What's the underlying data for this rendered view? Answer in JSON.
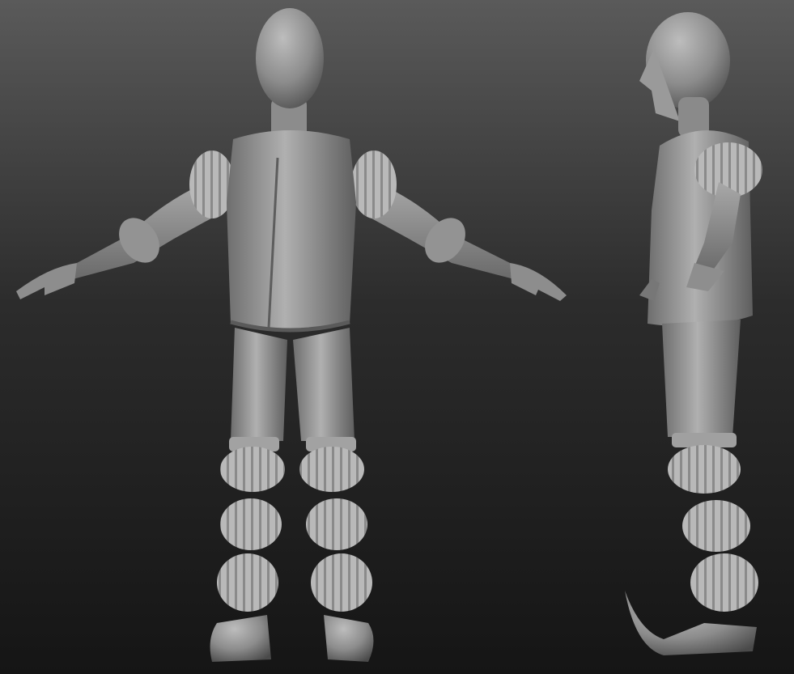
{
  "scene": {
    "background_top": "#5a5a5a",
    "background_mid": "#2c2c2c",
    "background_bottom": "#151515",
    "clay_light": "#b4b4b4",
    "clay_mid": "#8a8a8a",
    "clay_dark": "#4f4f4f",
    "views": [
      "front-view",
      "side-view"
    ]
  }
}
